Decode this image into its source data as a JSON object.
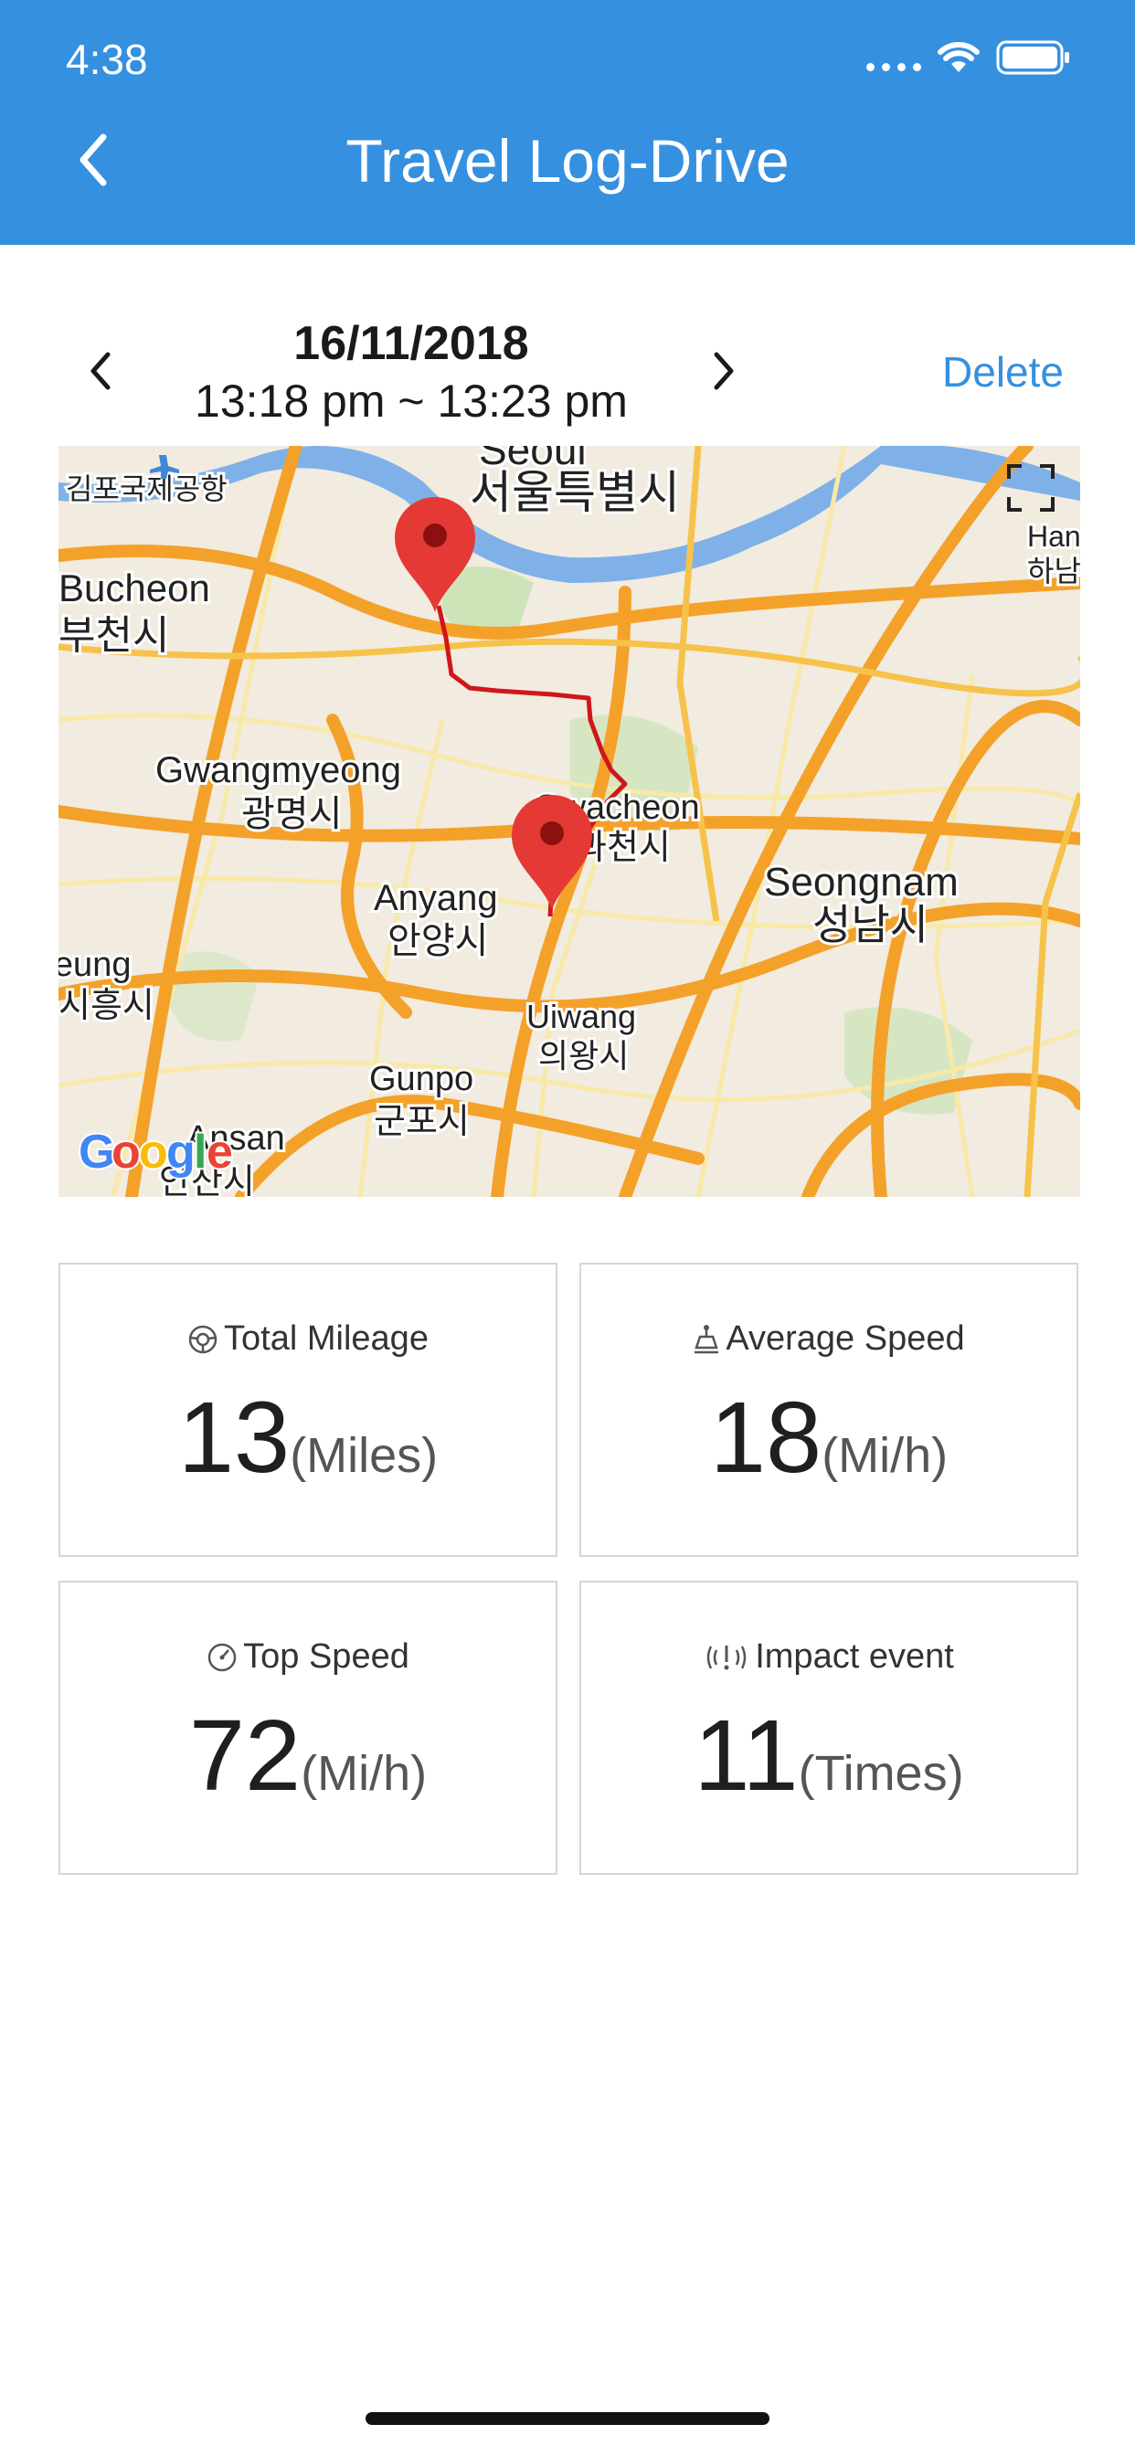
{
  "status_bar": {
    "time": "4:38"
  },
  "header": {
    "title": "Travel Log-Drive",
    "back_icon": "chevron-left-icon",
    "background_color": "#3590e0"
  },
  "trip": {
    "date": "16/11/2018",
    "time_range": "13:18 pm ~ 13:23 pm",
    "delete_label": "Delete",
    "accent_color": "#3590e0"
  },
  "map": {
    "labels": {
      "seoul_en": "Seoul",
      "seoul_ko": "서울특별시",
      "gimpo": "김포국제공항",
      "bucheon_en": "Bucheon",
      "bucheon_ko": "부천시",
      "gwangmyeong_en": "Gwangmyeong",
      "gwangmyeong_ko": "광명시",
      "gwacheon_en": "Gwacheon",
      "gwacheon_ko": "과천시",
      "seongnam_en": "Seongnam",
      "seongnam_ko": "성남시",
      "anyang_en": "Anyang",
      "anyang_ko": "안양시",
      "siheung_en": "Siheung",
      "siheung_ko": "시흥시",
      "uiwang_en": "Uiwang",
      "uiwang_ko": "의왕시",
      "gunpo_en": "Gunpo",
      "gunpo_ko": "군포시",
      "ansan_en": "Ansan",
      "ansan_ko": "안산시",
      "hanam_en": "Hanam",
      "hanam_ko": "하남시",
      "google": "Google"
    },
    "route_color": "#d0161b",
    "marker_color": "#e53935"
  },
  "stats": [
    {
      "icon": "steering-wheel-icon",
      "label": "Total Mileage",
      "value": "13",
      "unit": "(Miles)"
    },
    {
      "icon": "speed-level-icon",
      "label": "Average Speed",
      "value": "18",
      "unit": "(Mi/h)"
    },
    {
      "icon": "speedometer-icon",
      "label": "Top Speed",
      "value": "72",
      "unit": "(Mi/h)"
    },
    {
      "icon": "impact-alert-icon",
      "label": "Impact event",
      "value": "11",
      "unit": "(Times)"
    }
  ]
}
